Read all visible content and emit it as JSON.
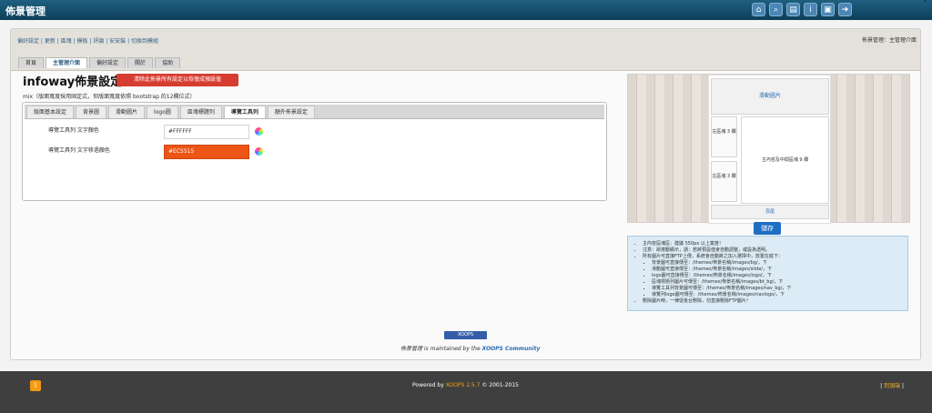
{
  "app": {
    "title": "佈景管理",
    "top_icons": [
      {
        "name": "home-icon",
        "glyph": "⌂"
      },
      {
        "name": "search-icon",
        "glyph": "⌕"
      },
      {
        "name": "document-icon",
        "glyph": "▤"
      },
      {
        "name": "info-icon",
        "glyph": "i"
      },
      {
        "name": "monitor-icon",
        "glyph": "▣"
      },
      {
        "name": "exit-icon",
        "glyph": "➜"
      }
    ],
    "top_right_mark": "'"
  },
  "header": {
    "quick_links": "偏好設定 | 更新 | 區塊 | 模板 | 評論 | 安安裝 | 切換到模組",
    "user_info": "佈景管理：主管理介面",
    "main_tabs": [
      {
        "label": "首頁"
      },
      {
        "label": "主管理介面",
        "active": true
      },
      {
        "label": "偏好設定"
      },
      {
        "label": "關於"
      },
      {
        "label": "協助"
      }
    ]
  },
  "page": {
    "title": "infoway佈景設定",
    "reset_button": "清除此佈景所有設定以恢復成預設值",
    "note": "mix（版面寬度採用固定式，但版面寬度依照 bootstrap 的12欄位式）"
  },
  "settings": {
    "subtabs": [
      {
        "label": "版面基本設定"
      },
      {
        "label": "背景圖"
      },
      {
        "label": "滑動圖片"
      },
      {
        "label": "logo圖"
      },
      {
        "label": "區塊標題列"
      },
      {
        "label": "導覽工具列",
        "active": true
      },
      {
        "label": "額外佈景設定"
      }
    ],
    "fields": [
      {
        "label": "導覽工具列 文字顏色",
        "value": "#FFFFFF",
        "color": "#FFFFFF"
      },
      {
        "label": "導覽工具列 文字移過顏色",
        "value": "#EC5515",
        "color": "#EC5515"
      }
    ]
  },
  "preview": {
    "slide": "滑動圖片",
    "left_block_1": "左區塊 3 欄",
    "left_block_2": "左區塊 3 欄",
    "main_block": "主內容及中間區塊 9 欄",
    "footer": "頁尾"
  },
  "save_button": "儲存",
  "info": {
    "items": [
      "主內容區塊區：建議 550px 以上寬度！",
      "注意：欲捲動顯示，請：若將預設值會自動調整，或設為透明。",
      "所有圖片可直接FTP上傳，系統會自動將之加入選擇中，放置在底下："
    ],
    "subitems": [
      "背景圖可直接傳至：/themes/佈景名稱/images/bg/，下",
      "滑動圖可直接傳至：/themes/佈景名稱/images/slide/，下",
      "logo圖可直接傳至：/themes/佈景名稱/images/logo/，下",
      "區塊標題列圖片可傳至：/themes/佈景名稱/images/bt_bg/，下",
      "導覽工具列背景圖可傳至：/themes/佈景名稱/images/nav_bg/，下",
      "導覽列logo圖可傳至：/themes/佈景名稱/images/navlogo/，下"
    ],
    "last_item": "刪除圖片時，一律從後台刪除，勿直接刪除FTP圖片！"
  },
  "footer_module": {
    "badge": "XOOPS",
    "maintained_pre": "佈景管理",
    "maintained_mid": " is maintained by the ",
    "maintained_link": "XOOPS Community"
  },
  "footer": {
    "powered_pre": "Powered by ",
    "powered_link": "XOOPS 2.5.7",
    "powered_post": " © 2001-2015",
    "top_link": "到頂端"
  }
}
